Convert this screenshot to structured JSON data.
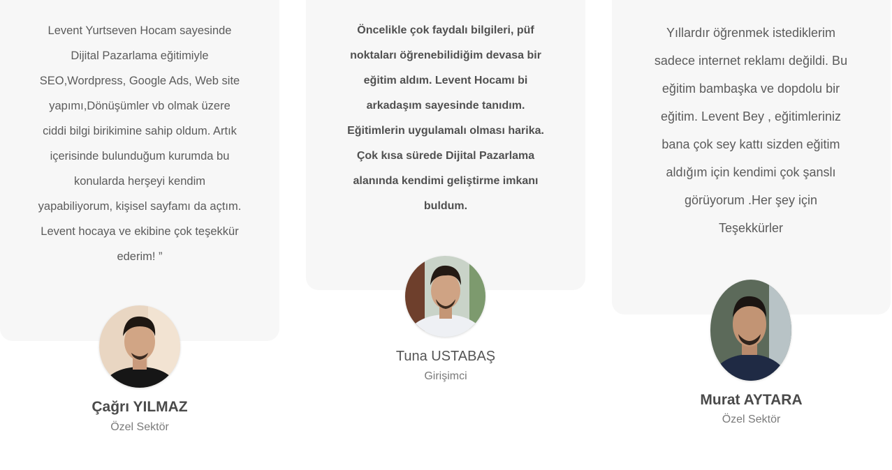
{
  "testimonials": [
    {
      "quote": "Levent Yurtseven Hocam  sayesinde\nDijital Pazarlama eğitimiyle\nSEO,Wordpress, Google Ads, Web site\nyapımı,Dönüşümler vb olmak üzere\nciddi bilgi birikimine sahip oldum. Artık\niçerisinde bulunduğum kurumda bu\nkonularda herşeyi kendim\nyapabiliyorum, kişisel sayfamı da açtım.\nLevent hocaya ve ekibine  çok teşekkür\nederim! ”",
      "name": "Çağrı YILMAZ",
      "role": "Özel Sektör"
    },
    {
      "quote": "Öncelikle çok faydalı bilgileri, püf\nnoktaları öğrenebilidiğim  devasa  bir\neğitim aldım.  Levent Hocamı bi\narkadaşım  sayesinde  tanıdım.\nEğitimlerin uygulamalı olması harika.\nÇok kısa sürede Dijital Pazarlama\nalanında kendimi geliştirme imkanı\nbuldum.",
      "name": "Tuna USTABAŞ",
      "role": "Girişimci"
    },
    {
      "quote": "Yıllardır öğrenmek istediklerim\nsadece internet reklamı değildi. Bu\neğitim bambaşka ve dopdolu bir\neğitim.  Levent Bey , eğitimleriniz\nbana çok sey kattı sizden eğitim\naldığım için kendimi çok şanslı\ngörüyorum .Her şey için\nTeşekkürler",
      "name": "Murat AYTARA",
      "role": "Özel Sektör"
    }
  ]
}
